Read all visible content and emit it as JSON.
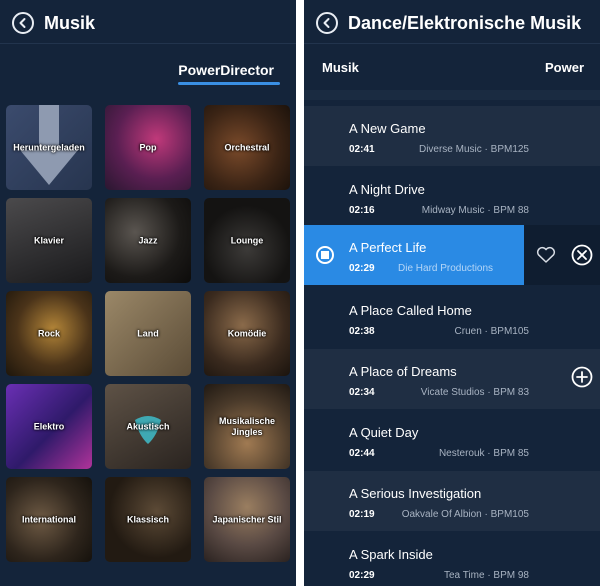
{
  "left": {
    "title": "Musik",
    "active_tab": "PowerDirector",
    "categories": [
      "Heruntergeladen",
      "Pop",
      "Orchestral",
      "Klavier",
      "Jazz",
      "Lounge",
      "Rock",
      "Land",
      "Komödie",
      "Elektro",
      "Akustisch",
      "Musikalische Jingles",
      "International",
      "Klassisch",
      "Japanischer Stil"
    ]
  },
  "right": {
    "title": "Dance/Elektronische Musik",
    "left_label": "Musik",
    "right_label": "Power",
    "tracks": [
      {
        "title": "A New Game",
        "time": "02:41",
        "meta": "Diverse Music  ·  BPM125"
      },
      {
        "title": "A Night Drive",
        "time": "02:16",
        "meta": "Midway Music  ·  BPM 88"
      },
      {
        "title": "A Perfect Life",
        "time": "02:29",
        "meta": "Die Hard Productions"
      },
      {
        "title": "A Place Called Home",
        "time": "02:38",
        "meta": "Cruen  ·  BPM105"
      },
      {
        "title": "A Place of Dreams",
        "time": "02:34",
        "meta": "Vicate Studios  ·  BPM 83"
      },
      {
        "title": "A Quiet Day",
        "time": "02:44",
        "meta": "Nesterouk  ·  BPM 85"
      },
      {
        "title": "A Serious Investigation",
        "time": "02:19",
        "meta": "Oakvale Of Albion  ·  BPM105"
      },
      {
        "title": "A Spark Inside",
        "time": "02:29",
        "meta": "Tea Time  ·  BPM 98"
      }
    ]
  }
}
